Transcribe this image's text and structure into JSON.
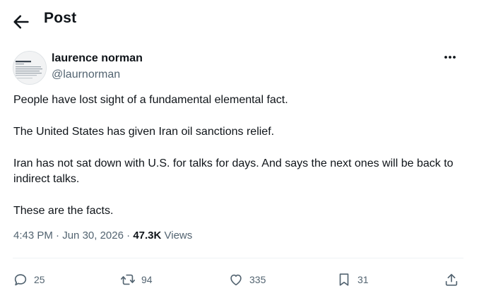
{
  "header": {
    "title": "Post"
  },
  "author": {
    "name": "laurence norman",
    "handle": "@laurnorman"
  },
  "post": {
    "paragraphs": [
      "People have lost sight of a fundamental elemental fact.",
      "The United States has given Iran oil sanctions relief.",
      "Iran has not sat down with U.S. for talks for days. And says the next ones will be back to indirect talks.",
      "These are the facts."
    ],
    "time": "4:43 PM",
    "date": "Jun 30, 2026",
    "views_count": "47.3K",
    "views_label": "Views"
  },
  "actions": {
    "replies": "25",
    "reposts": "94",
    "likes": "335",
    "bookmarks": "31"
  },
  "icons": [
    "back-arrow-icon",
    "more-icon",
    "reply-icon",
    "repost-icon",
    "like-icon",
    "bookmark-icon",
    "share-icon"
  ],
  "colors": {
    "text": "#0f1419",
    "secondary": "#536471",
    "divider": "#eff3f4",
    "background": "#ffffff"
  }
}
